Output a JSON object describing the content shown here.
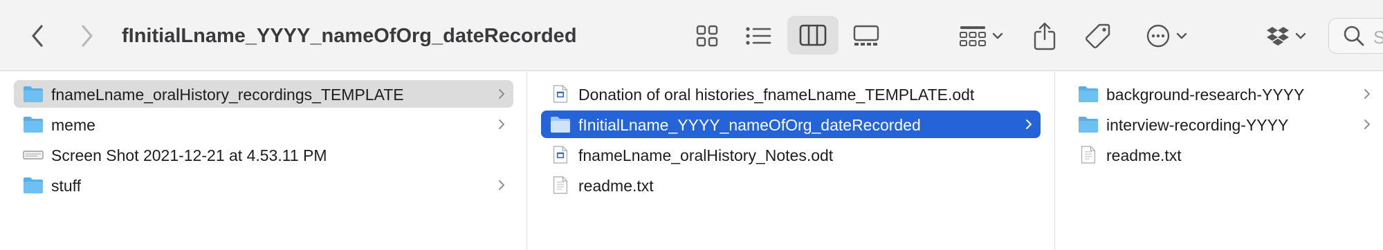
{
  "window": {
    "title": "fInitialLname_YYYY_nameOfOrg_dateRecorded",
    "search_placeholder": "S"
  },
  "toolbar": {
    "icons": [
      "back-icon",
      "forward-icon",
      "icon-view-icon",
      "list-view-icon",
      "column-view-icon",
      "gallery-view-icon",
      "group-icon",
      "share-icon",
      "tag-icon",
      "more-icon",
      "dropbox-icon",
      "search-icon"
    ],
    "active_view": "column"
  },
  "columns": [
    {
      "items": [
        {
          "label": "fnameLname_oralHistory_recordings_TEMPLATE",
          "type": "folder",
          "has_children": true,
          "selected": "inactive"
        },
        {
          "label": "meme",
          "type": "folder",
          "has_children": true,
          "selected": "none"
        },
        {
          "label": "Screen Shot 2021-12-21 at 4.53.11 PM",
          "type": "image",
          "has_children": false,
          "selected": "none"
        },
        {
          "label": "stuff",
          "type": "folder",
          "has_children": true,
          "selected": "none"
        }
      ]
    },
    {
      "items": [
        {
          "label": "Donation of oral histories_fnameLname_TEMPLATE.odt",
          "type": "odt",
          "has_children": false,
          "selected": "none"
        },
        {
          "label": "fInitialLname_YYYY_nameOfOrg_dateRecorded",
          "type": "folder",
          "has_children": true,
          "selected": "active"
        },
        {
          "label": "fnameLname_oralHistory_Notes.odt",
          "type": "odt",
          "has_children": false,
          "selected": "none"
        },
        {
          "label": "readme.txt",
          "type": "text",
          "has_children": false,
          "selected": "none"
        }
      ]
    },
    {
      "items": [
        {
          "label": "background-research-YYYY",
          "type": "folder",
          "has_children": true,
          "selected": "none"
        },
        {
          "label": "interview-recording-YYYY",
          "type": "folder",
          "has_children": true,
          "selected": "none"
        },
        {
          "label": "readme.txt",
          "type": "text",
          "has_children": false,
          "selected": "none"
        }
      ]
    }
  ],
  "colors": {
    "selection_active": "#2563d9",
    "selection_inactive": "#dcdcdc",
    "folder": "#5aaee6",
    "toolbar_bg": "#f3f3f3"
  }
}
